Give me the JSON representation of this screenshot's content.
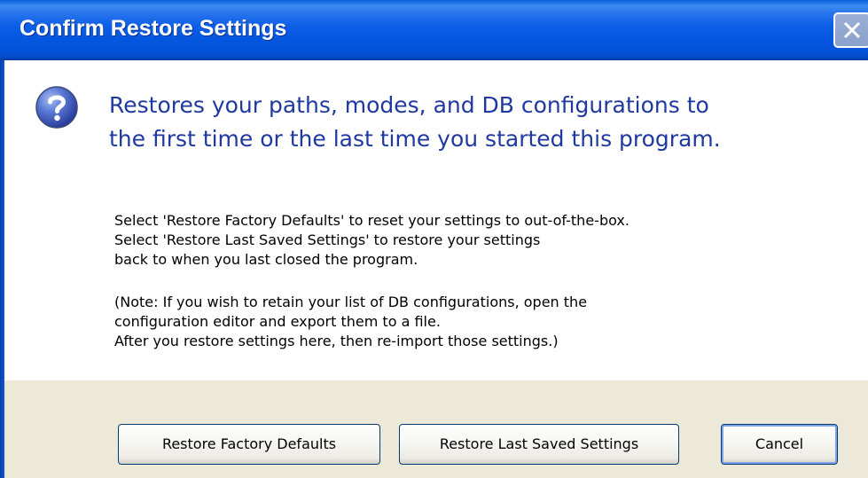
{
  "window": {
    "title": "Confirm Restore Settings",
    "close_icon": "close-icon"
  },
  "message": {
    "icon": "question-icon",
    "headline_lines": [
      "Restores your paths, modes, and DB configurations to",
      "the first time or the last time you started this program."
    ],
    "body_lines": [
      "Select 'Restore Factory Defaults' to reset your settings to out-of-the-box.",
      "Select 'Restore Last Saved Settings' to restore your settings",
      "back to when you last closed the program."
    ],
    "note_lines": [
      "(Note: If you wish to retain your list of DB configurations, open the",
      "configuration editor and export them to a file.",
      "After you restore settings here, then re-import those settings.)"
    ]
  },
  "buttons": {
    "factory_label": "Restore Factory Defaults",
    "last_saved_label": "Restore Last Saved Settings",
    "cancel_label": "Cancel"
  },
  "colors": {
    "titlebar": "#0556df",
    "headline_text": "#1f39a0",
    "button_strip": "#ece9d8",
    "icon_blue": "#3a5bbf"
  }
}
